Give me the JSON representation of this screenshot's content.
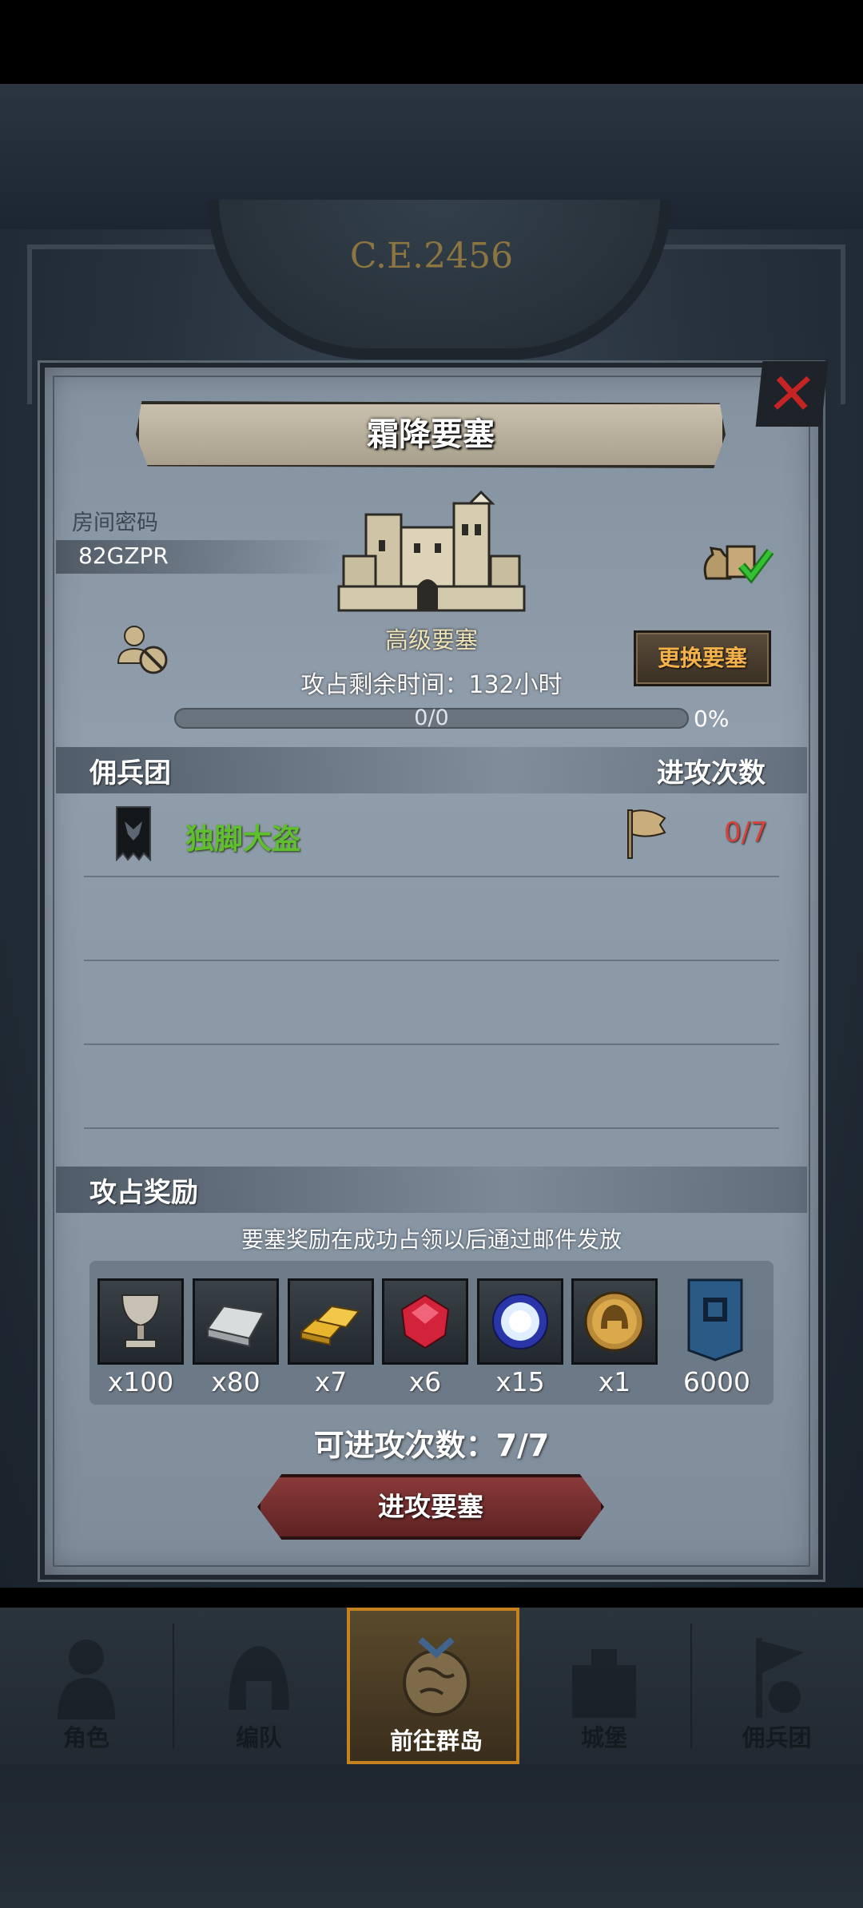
{
  "era": "C.E.2456",
  "dialog": {
    "title": "霜降要塞",
    "room_label": "房间密码",
    "room_code": "82GZPR",
    "fortress_name": "高级要塞",
    "change_button": "更换要塞",
    "time_remaining": "攻占剩余时间：132小时",
    "progress": {
      "text": "0/0",
      "percent_text": "0%",
      "value": 0
    },
    "mercenary_section": {
      "title": "佣兵团",
      "attacks_header": "进攻次数"
    },
    "mercenaries": [
      {
        "name": "独脚大盗",
        "attacks": "0/7"
      }
    ],
    "rewards_section": {
      "title": "攻占奖励",
      "note": "要塞奖励在成功占领以后通过邮件发放",
      "items": [
        {
          "icon": "goblet-icon",
          "qty": "x100"
        },
        {
          "icon": "iron-ingot-icon",
          "qty": "x80"
        },
        {
          "icon": "gold-bars-icon",
          "qty": "x7"
        },
        {
          "icon": "ruby-icon",
          "qty": "x6"
        },
        {
          "icon": "crystal-orb-icon",
          "qty": "x15"
        },
        {
          "icon": "helmet-medal-icon",
          "qty": "x1"
        },
        {
          "icon": "guild-shield-icon",
          "qty": "6000"
        }
      ]
    },
    "attacks_available": "可进攻次数：7/7",
    "attack_button": "进攻要塞"
  },
  "nav": [
    {
      "label": "角色",
      "icon": "knight-icon",
      "active": false
    },
    {
      "label": "编队",
      "icon": "helmet-icon",
      "active": false
    },
    {
      "label": "前往群岛",
      "icon": "globe-icon",
      "active": true
    },
    {
      "label": "城堡",
      "icon": "castle-icon",
      "active": false
    },
    {
      "label": "佣兵团",
      "icon": "mercenary-icon",
      "active": false
    }
  ],
  "colors": {
    "mercenary_name": "#5fbf2c",
    "attack_count": "#d7433b",
    "change_button_text": "#f6b24a",
    "close": "#c62424",
    "nav_active_border": "#c6821e"
  }
}
